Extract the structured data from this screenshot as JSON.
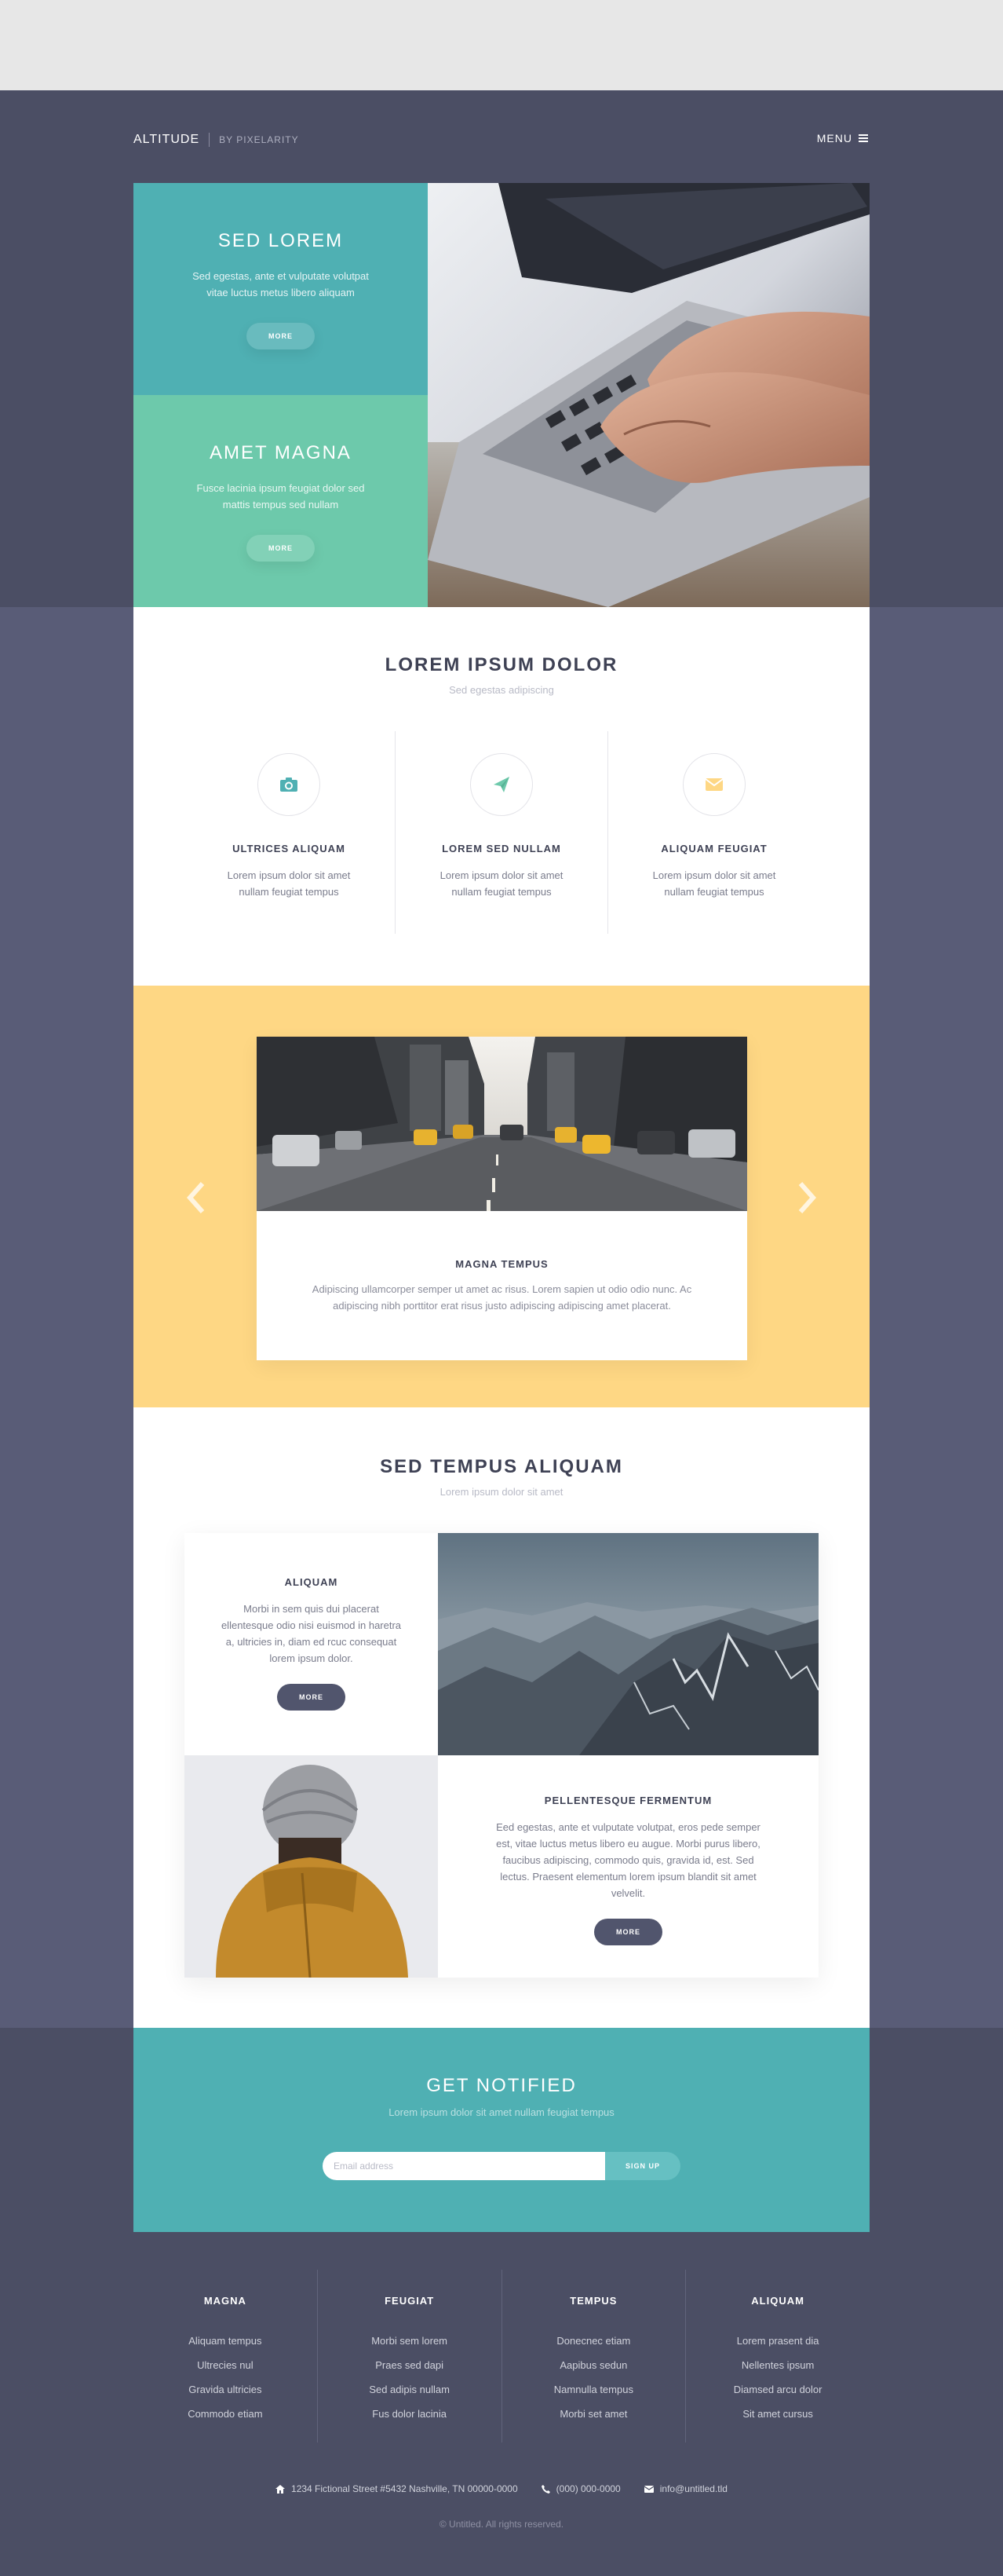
{
  "header": {
    "brand": "ALTITUDE",
    "byline": "BY PIXELARITY",
    "menu_label": "MENU"
  },
  "hero": {
    "panels": [
      {
        "title": "SED LOREM",
        "text": "Sed egestas, ante et vulputate volutpat vitae luctus metus libero aliquam",
        "button": "MORE"
      },
      {
        "title": "AMET MAGNA",
        "text": "Fusce lacinia ipsum feugiat dolor sed mattis tempus sed nullam",
        "button": "MORE"
      }
    ],
    "image": "laptop-typing-photo"
  },
  "features": {
    "title": "LOREM IPSUM DOLOR",
    "subtitle": "Sed egestas adipiscing",
    "items": [
      {
        "icon": "camera-icon",
        "title": "ULTRICES ALIQUAM",
        "text": "Lorem ipsum dolor sit amet nullam feugiat tempus"
      },
      {
        "icon": "paper-plane-icon",
        "title": "LOREM SED NULLAM",
        "text": "Lorem ipsum dolor sit amet nullam feugiat tempus"
      },
      {
        "icon": "envelope-icon",
        "title": "ALIQUAM FEUGIAT",
        "text": "Lorem ipsum dolor sit amet nullam feugiat tempus"
      }
    ]
  },
  "carousel": {
    "image": "city-street-photo",
    "title": "MAGNA TEMPUS",
    "text": "Adipiscing ullamcorper semper ut amet ac risus. Lorem sapien ut odio odio nunc. Ac adipiscing nibh porttitor erat risus justo adipiscing adipiscing amet placerat."
  },
  "spotlights": {
    "title": "SED TEMPUS ALIQUAM",
    "subtitle": "Lorem ipsum dolor sit amet",
    "items": [
      {
        "title": "ALIQUAM",
        "text": "Morbi in sem quis dui placerat ellentesque odio nisi euismod in haretra a, ultricies in, diam ed rcuc consequat lorem ipsum dolor.",
        "button": "MORE",
        "image": "mountains-photo"
      },
      {
        "title": "PELLENTESQUE FERMENTUM",
        "text": "Eed egestas, ante et vulputate volutpat, eros pede semper est, vitae luctus metus libero eu augue. Morbi purus libero, faucibus adipiscing, commodo quis, gravida id, est. Sed lectus. Praesent elementum lorem ipsum blandit sit amet velvelit.",
        "button": "MORE",
        "image": "person-in-beanie-photo"
      }
    ]
  },
  "notify": {
    "title": "GET NOTIFIED",
    "subtitle": "Lorem ipsum dolor sit amet nullam feugiat tempus",
    "placeholder": "Email address",
    "button": "SIGN UP"
  },
  "footer": {
    "columns": [
      {
        "title": "MAGNA",
        "links": [
          "Aliquam tempus",
          "Ultrecies nul",
          "Gravida ultricies",
          "Commodo etiam"
        ]
      },
      {
        "title": "FEUGIAT",
        "links": [
          "Morbi sem lorem",
          "Praes sed dapi",
          "Sed adipis nullam",
          "Fus dolor lacinia"
        ]
      },
      {
        "title": "TEMPUS",
        "links": [
          "Donecnec etiam",
          "Aapibus sedun",
          "Namnulla tempus",
          "Morbi set amet"
        ]
      },
      {
        "title": "ALIQUAM",
        "links": [
          "Lorem prasent dia",
          "Nellentes ipsum",
          "Diamsed arcu dolor",
          "Sit amet cursus"
        ]
      }
    ],
    "address": "1234 Fictional Street #5432 Nashville, TN 00000-0000",
    "phone": "(000) 000-0000",
    "email": "info@untitled.tld",
    "copyright": "© Untitled. All rights reserved."
  },
  "colors": {
    "teal": "#4fb0b3",
    "mint": "#6dc9ab",
    "yellow": "#fed784",
    "dark": "#4b4e64",
    "slate": "#595c77"
  }
}
